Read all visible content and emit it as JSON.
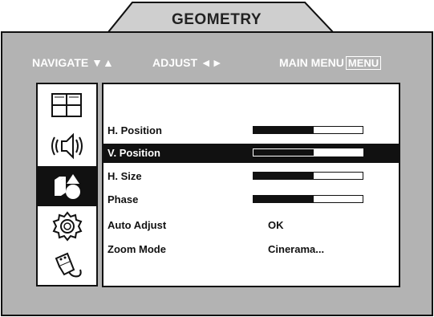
{
  "title": "GEOMETRY",
  "nav": {
    "navigate_label": "NAVIGATE",
    "navigate_arrows": "▼▲",
    "adjust_label": "ADJUST",
    "adjust_arrows": "◄►",
    "main_menu_label": "MAIN MENU",
    "menu_key": "MENU"
  },
  "sidebar_icons": [
    "picture-icon",
    "audio-icon",
    "geometry-icon",
    "settings-icon",
    "connection-icon"
  ],
  "selected_icon": "geometry-icon",
  "rows": [
    {
      "label": "H. Position",
      "type": "slider",
      "level": 0.55
    },
    {
      "label": "V. Position",
      "type": "slider",
      "level": 0.55,
      "selected": true
    },
    {
      "label": "H. Size",
      "type": "slider",
      "level": 0.55
    },
    {
      "label": "Phase",
      "type": "slider",
      "level": 0.55
    },
    {
      "label": "Auto Adjust",
      "type": "text",
      "value": "OK"
    },
    {
      "label": "Zoom Mode",
      "type": "text",
      "value": "Cinerama..."
    }
  ],
  "colors": {
    "frame": "#b3b3b3",
    "frame_dark": "#8f8f8f",
    "tab": "#cfcfcf",
    "text_on_frame": "#ffffff",
    "panel": "#ffffff",
    "selection": "#111111"
  }
}
